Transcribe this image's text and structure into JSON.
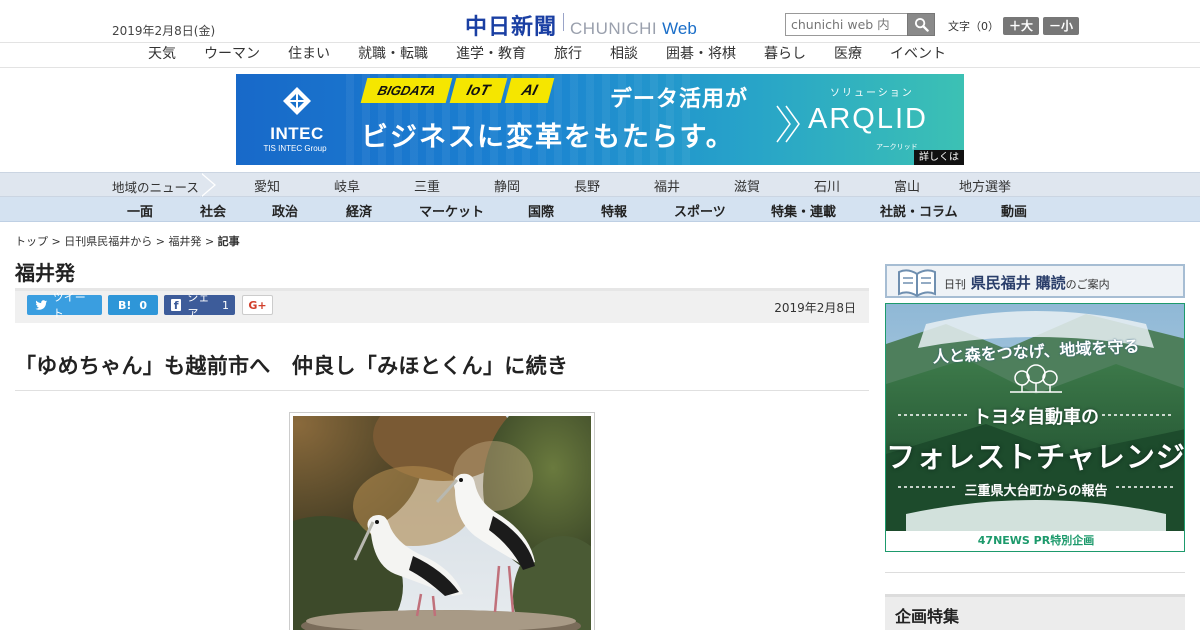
{
  "header": {
    "date": "2019年2月8日(金)",
    "logo_jp": "中日新聞",
    "logo_en": "CHUNICHI",
    "logo_web": "Web",
    "search_placeholder": "chunichi web 内",
    "font_label": "文字（0）",
    "font_larger": "＋大",
    "font_smaller": "－小"
  },
  "subnav": [
    "天気",
    "ウーマン",
    "住まい",
    "就職・転職",
    "進学・教育",
    "旅行",
    "相談",
    "囲碁・将棋",
    "暮らし",
    "医療",
    "イベント"
  ],
  "banner": {
    "brand": "INTEC",
    "brand_sub": "TIS INTEC Group",
    "tags": [
      "BIGDATA",
      "IoT",
      "AI"
    ],
    "line1": "データ活用が",
    "line2": "ビジネスに変革をもたらす。",
    "solution_label": "ソリューション",
    "product": "ARQLID",
    "product_kana": "アークリッド",
    "more": "詳しくは",
    "colors": {
      "tag": "#f5e600",
      "bg_start": "#1869c9",
      "bg_end": "#3cc1b4"
    }
  },
  "region_nav": {
    "label": "地域のニュース",
    "items": [
      "愛知",
      "岐阜",
      "三重",
      "静岡",
      "長野",
      "福井",
      "滋賀",
      "石川",
      "富山",
      "地方選挙"
    ]
  },
  "category_nav": [
    "一面",
    "社会",
    "政治",
    "経済",
    "マーケット",
    "国際",
    "特報",
    "スポーツ",
    "特集・連載",
    "社説・コラム",
    "動画"
  ],
  "breadcrumb": {
    "items": [
      "トップ",
      "日刊県民福井から",
      "福井発"
    ],
    "current": "記事",
    "separator": ">"
  },
  "section_title": "福井発",
  "share": {
    "tweet": "ツイート",
    "hatena_count": "0",
    "facebook": "シェア",
    "facebook_count": "1",
    "gplus": "G+"
  },
  "article": {
    "date": "2019年2月8日",
    "headline": "「ゆめちゃん」も越前市へ　仲良し「みほとくん」に続き"
  },
  "sidebar": {
    "subscribe_small": "日刊",
    "subscribe_big": "県民福井",
    "subscribe_buy": "購読",
    "subscribe_rest": "のご案内",
    "ad_top": "人と森をつなげ、地域を守る",
    "ad_sub1": "トヨタ自動車の",
    "ad_main": "フォレストチャレンジ",
    "ad_sub2": "三重県大台町からの報告",
    "ad_foot": "47NEWS PR特別企画",
    "section_heading": "企画特集"
  }
}
